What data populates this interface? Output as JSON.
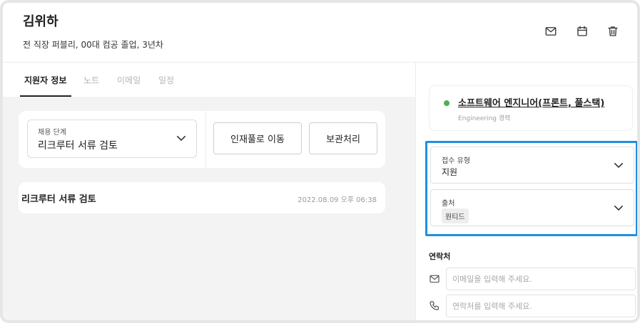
{
  "candidate": {
    "name": "김위하",
    "subtitle": "전 직장 퍼블리, 00대 컴공 졸업, 3년차"
  },
  "header_actions": [
    {
      "icon": "mail-icon"
    },
    {
      "icon": "calendar-icon"
    },
    {
      "icon": "trash-icon"
    }
  ],
  "tabs": [
    {
      "label": "지원자 정보",
      "active": true
    },
    {
      "label": "노트",
      "active": false
    },
    {
      "label": "이메일",
      "active": false
    },
    {
      "label": "일정",
      "active": false
    }
  ],
  "stage": {
    "label": "채용 단계",
    "value": "리크루터 서류 검토",
    "move_button": "인재풀로 이동",
    "archive_button": "보관처리"
  },
  "history": {
    "title": "리크루터 서류 검토",
    "time": "2022.08.09 오후 06:38"
  },
  "job": {
    "title": "소프트웨어 엔지니어(프론트, 풀스택)",
    "subtitle": "Engineering 경력",
    "status_color": "#4caf50"
  },
  "application_type": {
    "label": "접수 유형",
    "value": "지원"
  },
  "source": {
    "label": "출처",
    "value": "원티드"
  },
  "contact": {
    "title": "연락처",
    "email_placeholder": "이메일을 입력해 주세요.",
    "phone_placeholder": "연락처를 입력해 주세요."
  },
  "colors": {
    "highlight": "#1e90e0",
    "status_green": "#4caf50",
    "panel_bg": "#f3f3f3"
  }
}
